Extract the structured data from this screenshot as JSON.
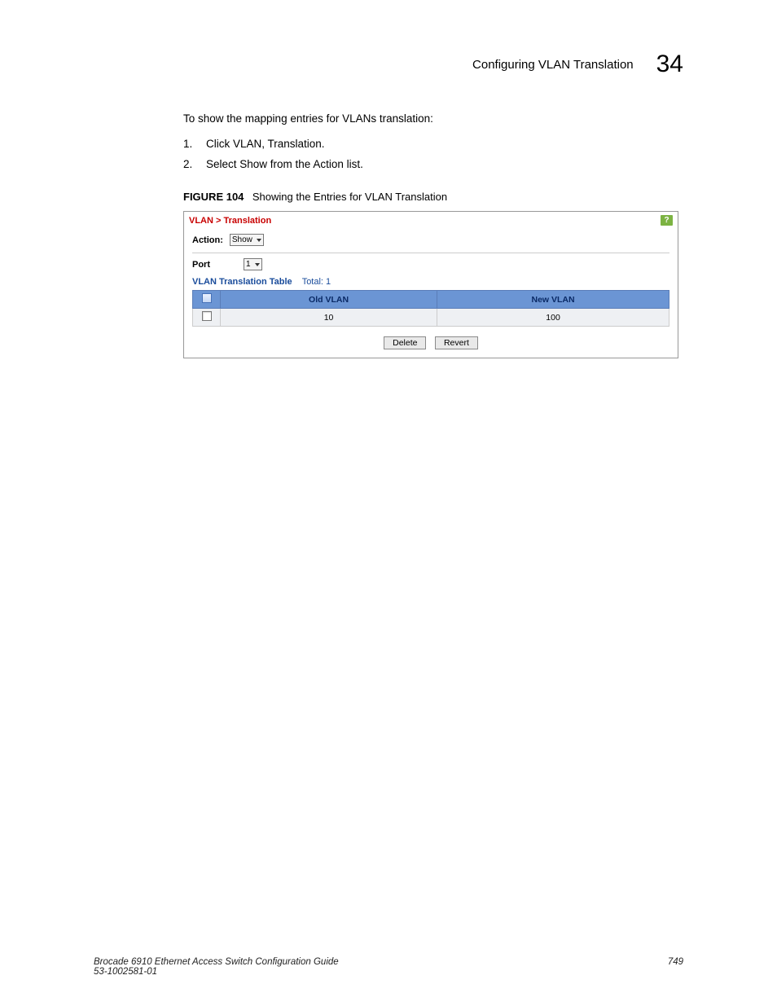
{
  "header": {
    "title": "Configuring VLAN Translation",
    "chapter": "34"
  },
  "intro": "To show the mapping entries for VLANs translation:",
  "steps": [
    "Click VLAN, Translation.",
    "Select Show from the Action list."
  ],
  "figure": {
    "label": "FIGURE 104",
    "caption": "Showing the Entries for VLAN Translation"
  },
  "screenshot": {
    "breadcrumb": "VLAN > Translation",
    "help": "?",
    "action_label": "Action:",
    "action_value": "Show",
    "port_label": "Port",
    "port_value": "1",
    "table_title": "VLAN Translation Table",
    "total_label": "Total:",
    "total_value": "1",
    "columns": [
      "Old VLAN",
      "New VLAN"
    ],
    "rows": [
      {
        "old": "10",
        "new": "100"
      }
    ],
    "buttons": {
      "delete": "Delete",
      "revert": "Revert"
    }
  },
  "footer": {
    "guide": "Brocade 6910 Ethernet Access Switch Configuration Guide",
    "docnum": "53-1002581-01",
    "page": "749"
  }
}
